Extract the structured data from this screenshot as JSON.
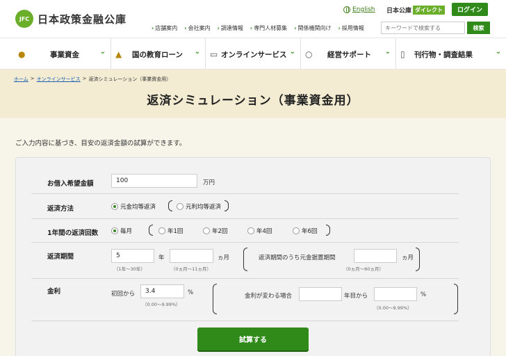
{
  "header": {
    "logo_mark": "JFC",
    "logo_text": "日本政策金融公庫",
    "english": "English",
    "direct_prefix": "日本公庫",
    "direct_badge": "ダイレクト",
    "login": "ログイン",
    "util_links": [
      "店舗案内",
      "会社案内",
      "調達情報",
      "専門人材募集",
      "関係機関向け",
      "採用情報"
    ],
    "search_placeholder": "キーワードで検索する",
    "search_button": "検索"
  },
  "nav": {
    "items": [
      {
        "label": "事業資金",
        "icon": "coins-icon"
      },
      {
        "label": "国の教育ローン",
        "icon": "graduation-cap-icon"
      },
      {
        "label": "オンラインサービス",
        "icon": "laptop-icon"
      },
      {
        "label": "経営サポート",
        "icon": "lightbulb-icon"
      },
      {
        "label": "刊行物・調査結果",
        "icon": "document-icon"
      }
    ]
  },
  "breadcrumb": {
    "home": "ホーム",
    "online": "オンラインサービス",
    "current": "返済シミュレーション（事業資金用）",
    "sep": ">"
  },
  "page": {
    "title": "返済シミュレーション（事業資金用）",
    "intro": "ご入力内容に基づき、目安の返済金額の試算ができます。"
  },
  "form": {
    "amount": {
      "label": "お借入希望金額",
      "value": "100",
      "unit": "万円"
    },
    "method": {
      "label": "返済方法",
      "opt1": "元金均等返済",
      "opt2": "元利均等返済",
      "selected": "元金均等返済"
    },
    "count": {
      "label": "1年間の返済回数",
      "opt1": "毎月",
      "opt2": "年1回",
      "opt3": "年2回",
      "opt4": "年4回",
      "opt5": "年6回",
      "selected": "毎月"
    },
    "period": {
      "label": "返済期間",
      "years_value": "5",
      "years_unit": "年",
      "years_hint": "（1年〜30年）",
      "months_value": "",
      "months_unit": "ヵ月",
      "months_hint": "（0ヵ月〜11ヵ月）",
      "grace_label": "返済期間のうち元金据置期間",
      "grace_value": "",
      "grace_unit": "ヵ月",
      "grace_hint": "（0ヵ月〜60ヵ月）"
    },
    "rate": {
      "label": "金利",
      "initial_label": "初回から",
      "initial_value": "3.4",
      "initial_unit": "%",
      "initial_hint": "（0.00〜9.99%）",
      "change_label": "金利が変わる場合",
      "change_year_value": "",
      "change_year_unit": "年目から",
      "change_rate_value": "",
      "change_rate_unit": "%",
      "change_hint": "（0.00〜9.99%）"
    },
    "submit": "試算する"
  }
}
